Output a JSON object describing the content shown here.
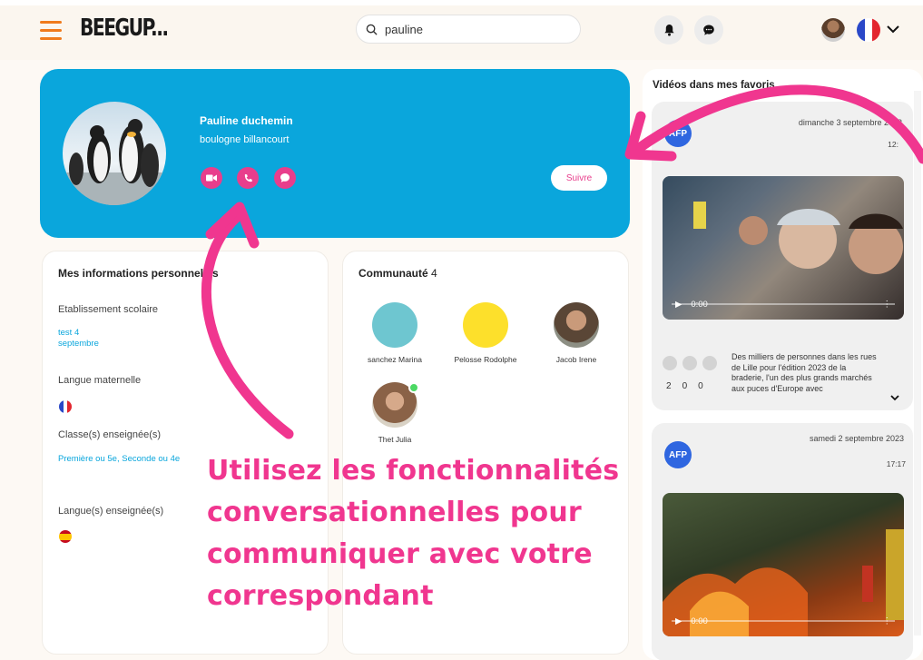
{
  "header": {
    "brand": "BEEGUP...",
    "search_value": "pauline",
    "accent_color": "#f07b1d"
  },
  "profile": {
    "name": "Pauline duchemin",
    "city": "boulogne billancourt",
    "follow_label": "Suivre",
    "card_color": "#0aa6dc",
    "action_icons": [
      "video-icon",
      "phone-icon",
      "chat-icon"
    ]
  },
  "info": {
    "title": "Mes informations personnelles",
    "school_label": "Etablissement scolaire",
    "school_value_1": "test 4",
    "school_value_2": "septembre",
    "mother_tongue_label": "Langue maternelle",
    "classes_label": "Classe(s) enseignée(s)",
    "classes_value": "Première ou 5e, Seconde ou 4e",
    "languages_label": "Langue(s) enseignée(s)"
  },
  "community": {
    "title": "Communauté",
    "count": "4",
    "members": [
      {
        "name": "sanchez Marina",
        "color": "#6ec6d0"
      },
      {
        "name": "Pelosse Rodolphe",
        "color": "#fde02b"
      },
      {
        "name": "Jacob Irene",
        "color": "#6b5a48"
      },
      {
        "name": "Thet Julia",
        "color": "#a07a5c"
      }
    ]
  },
  "sidebar": {
    "title": "Vidéos dans mes favoris",
    "videos": [
      {
        "source": "AFP",
        "date": "dimanche 3 septembre 2023",
        "time": "12:",
        "duration": "0:00",
        "likes": "2",
        "shares": "0",
        "reports": "0",
        "description": "Des milliers de personnes dans les rues de Lille pour l'édition 2023 de la braderie, l'un des plus grands marchés aux puces d'Europe avec"
      },
      {
        "source": "AFP",
        "date": "samedi 2 septembre 2023",
        "time": "17:17",
        "duration": "0:00"
      }
    ]
  },
  "overlay": {
    "line1": "Utilisez les fonctionnalités",
    "line2": "conversationnelles pour",
    "line3": "communiquer avec votre",
    "line4": "correspondant",
    "color": "#f0368f"
  }
}
